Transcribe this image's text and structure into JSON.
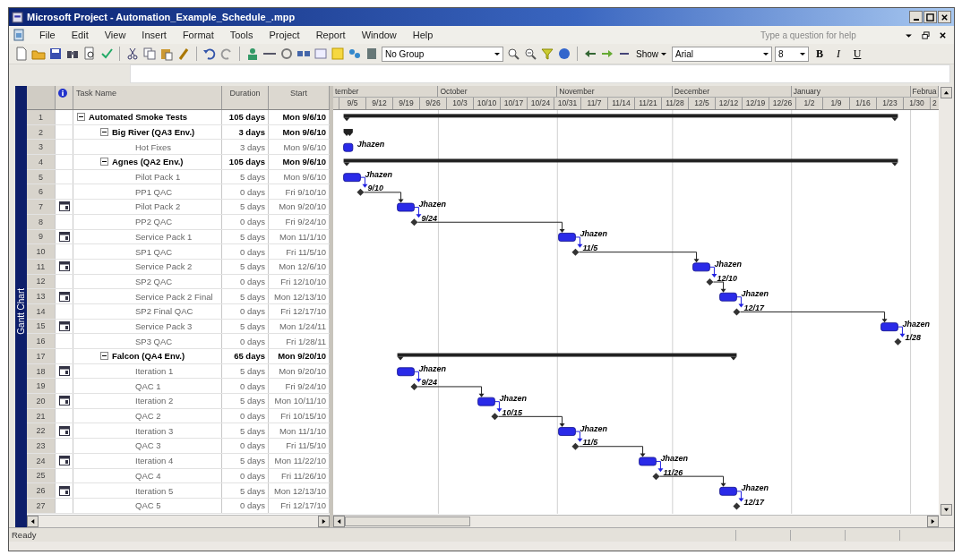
{
  "window": {
    "title": "Microsoft Project - Automation_Example_Schedule_.mpp"
  },
  "menu": [
    "File",
    "Edit",
    "View",
    "Insert",
    "Format",
    "Tools",
    "Project",
    "Report",
    "Window",
    "Help"
  ],
  "help_box": {
    "placeholder": "Type a question for help"
  },
  "toolbar": {
    "group_select": "No Group",
    "show_button": "Show",
    "font": "Arial",
    "font_size": "8",
    "bold": "B",
    "italic": "I",
    "underline": "U"
  },
  "view_bar": {
    "label": "Gantt Chart"
  },
  "table": {
    "columns": [
      "Task Name",
      "Duration",
      "Start"
    ],
    "tasks": [
      {
        "row": "1",
        "name": "Automated Smoke Tests",
        "duration": "105 days",
        "start": "Mon 9/6/10",
        "kind": "summary",
        "expanded": true,
        "has_note": false,
        "children": [
          {
            "row": "2",
            "name": "Big River (QA3 Env.)",
            "duration": "3 days",
            "start": "Mon 9/6/10",
            "kind": "summary",
            "expanded": true,
            "has_note": false,
            "children": [
              {
                "row": "3",
                "name": "Hot Fixes",
                "duration": "3 days",
                "start": "Mon 9/6/10",
                "kind": "task",
                "has_note": false,
                "bar_label": "Jhazen"
              }
            ]
          },
          {
            "row": "4",
            "name": "Agnes (QA2 Env.)",
            "duration": "105 days",
            "start": "Mon 9/6/10",
            "kind": "summary",
            "expanded": true,
            "has_note": false,
            "children": [
              {
                "row": "5",
                "name": "Pilot Pack 1",
                "duration": "5 days",
                "start": "Mon 9/6/10",
                "kind": "task",
                "has_note": false,
                "bar_label": "Jhazen"
              },
              {
                "row": "6",
                "name": "PP1 QAC",
                "duration": "0 days",
                "start": "Fri 9/10/10",
                "kind": "milestone",
                "has_note": false,
                "bar_label": "9/10"
              },
              {
                "row": "7",
                "name": "Pilot Pack 2",
                "duration": "5 days",
                "start": "Mon 9/20/10",
                "kind": "task",
                "has_note": true,
                "bar_label": "Jhazen"
              },
              {
                "row": "8",
                "name": "PP2 QAC",
                "duration": "0 days",
                "start": "Fri 9/24/10",
                "kind": "milestone",
                "has_note": false,
                "bar_label": "9/24"
              },
              {
                "row": "9",
                "name": "Service Pack 1",
                "duration": "5 days",
                "start": "Mon 11/1/10",
                "kind": "task",
                "has_note": true,
                "bar_label": "Jhazen"
              },
              {
                "row": "10",
                "name": "SP1 QAC",
                "duration": "0 days",
                "start": "Fri 11/5/10",
                "kind": "milestone",
                "has_note": false,
                "bar_label": "11/5"
              },
              {
                "row": "11",
                "name": "Service Pack 2",
                "duration": "5 days",
                "start": "Mon 12/6/10",
                "kind": "task",
                "has_note": true,
                "bar_label": "Jhazen"
              },
              {
                "row": "12",
                "name": "SP2 QAC",
                "duration": "0 days",
                "start": "Fri 12/10/10",
                "kind": "milestone",
                "has_note": false,
                "bar_label": "12/10"
              },
              {
                "row": "13",
                "name": "Service Pack 2 Final",
                "duration": "5 days",
                "start": "Mon 12/13/10",
                "kind": "task",
                "has_note": true,
                "bar_label": "Jhazen"
              },
              {
                "row": "14",
                "name": "SP2 Final QAC",
                "duration": "0 days",
                "start": "Fri 12/17/10",
                "kind": "milestone",
                "has_note": false,
                "bar_label": "12/17"
              },
              {
                "row": "15",
                "name": "Service Pack 3",
                "duration": "5 days",
                "start": "Mon 1/24/11",
                "kind": "task",
                "has_note": true,
                "bar_label": "Jhazen"
              },
              {
                "row": "16",
                "name": "SP3 QAC",
                "duration": "0 days",
                "start": "Fri 1/28/11",
                "kind": "milestone",
                "has_note": false,
                "bar_label": "1/28"
              }
            ]
          },
          {
            "row": "17",
            "name": "Falcon (QA4 Env.)",
            "duration": "65 days",
            "start": "Mon 9/20/10",
            "kind": "summary",
            "expanded": true,
            "has_note": false,
            "children": [
              {
                "row": "18",
                "name": "Iteration 1",
                "duration": "5 days",
                "start": "Mon 9/20/10",
                "kind": "task",
                "has_note": true,
                "bar_label": "Jhazen"
              },
              {
                "row": "19",
                "name": "QAC 1",
                "duration": "0 days",
                "start": "Fri 9/24/10",
                "kind": "milestone",
                "has_note": false,
                "bar_label": "9/24"
              },
              {
                "row": "20",
                "name": "Iteration 2",
                "duration": "5 days",
                "start": "Mon 10/11/10",
                "kind": "task",
                "has_note": true,
                "bar_label": "Jhazen"
              },
              {
                "row": "21",
                "name": "QAC 2",
                "duration": "0 days",
                "start": "Fri 10/15/10",
                "kind": "milestone",
                "has_note": false,
                "bar_label": "10/15"
              },
              {
                "row": "22",
                "name": "Iteration 3",
                "duration": "5 days",
                "start": "Mon 11/1/10",
                "kind": "task",
                "has_note": true,
                "bar_label": "Jhazen"
              },
              {
                "row": "23",
                "name": "QAC 3",
                "duration": "0 days",
                "start": "Fri 11/5/10",
                "kind": "milestone",
                "has_note": false,
                "bar_label": "11/5"
              },
              {
                "row": "24",
                "name": "Iteration 4",
                "duration": "5 days",
                "start": "Mon 11/22/10",
                "kind": "task",
                "has_note": true,
                "bar_label": "Jhazen"
              },
              {
                "row": "25",
                "name": "QAC 4",
                "duration": "0 days",
                "start": "Fri 11/26/10",
                "kind": "milestone",
                "has_note": false,
                "bar_label": "11/26"
              },
              {
                "row": "26",
                "name": "Iteration 5",
                "duration": "5 days",
                "start": "Mon 12/13/10",
                "kind": "task",
                "has_note": true,
                "bar_label": "Jhazen"
              },
              {
                "row": "27",
                "name": "QAC 5",
                "duration": "0 days",
                "start": "Fri 12/17/10",
                "kind": "milestone",
                "has_note": false,
                "bar_label": "12/17"
              }
            ]
          }
        ]
      }
    ]
  },
  "timescale": {
    "months": [
      "tember",
      "October",
      "November",
      "December",
      "January",
      "Februa"
    ],
    "weeks": [
      "9/5",
      "9/12",
      "9/19",
      "9/26",
      "10/3",
      "10/10",
      "10/17",
      "10/24",
      "10/31",
      "11/7",
      "11/14",
      "11/21",
      "11/28",
      "12/5",
      "12/12",
      "12/19",
      "12/26",
      "1/2",
      "1/9",
      "1/16",
      "1/23",
      "1/30",
      "2"
    ]
  },
  "status_bar": {
    "text": "Ready"
  }
}
